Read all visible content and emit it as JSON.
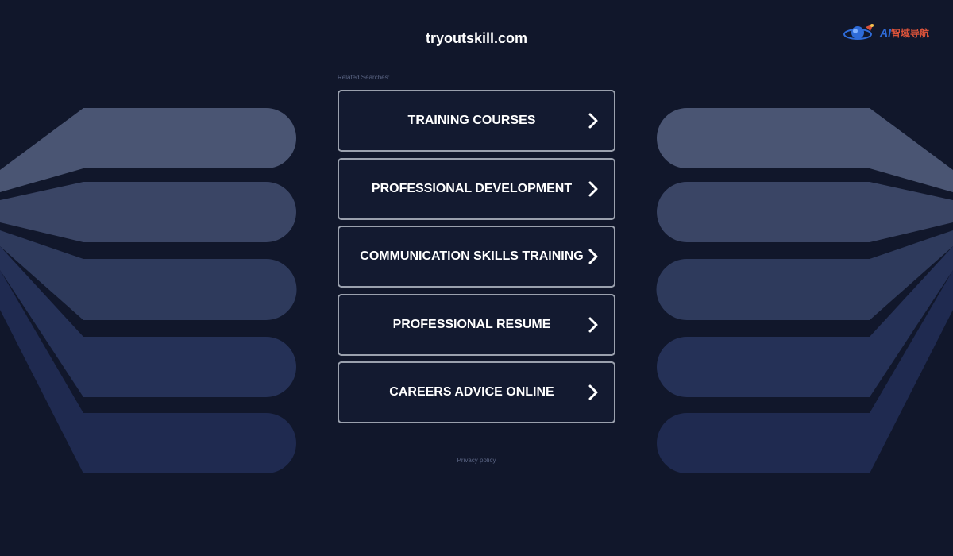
{
  "header": {
    "domain": "tryoutskill.com"
  },
  "logo": {
    "ai_text": "AI",
    "cn_text": "智域导航",
    "icon": "rocket-planet-icon"
  },
  "related": {
    "label": "Related Searches:"
  },
  "links": [
    {
      "label": "TRAINING COURSES",
      "icon": "chevron-right-icon"
    },
    {
      "label": "PROFESSIONAL DEVELOPMENT",
      "icon": "chevron-right-icon"
    },
    {
      "label": "COMMUNICATION SKILLS TRAINING",
      "icon": "chevron-right-icon"
    },
    {
      "label": "PROFESSIONAL RESUME",
      "icon": "chevron-right-icon"
    },
    {
      "label": "CAREERS ADVICE ONLINE",
      "icon": "chevron-right-icon"
    }
  ],
  "footer": {
    "privacy": "Privacy policy"
  },
  "colors": {
    "background": "#11172b",
    "shape_top": "#4a5573",
    "shape_2": "#3a4565",
    "shape_3": "#2e3a5c",
    "shape_4": "#253157",
    "shape_5": "#1f2a50",
    "link_border": "#9aa0ad",
    "text": "#ffffff"
  }
}
